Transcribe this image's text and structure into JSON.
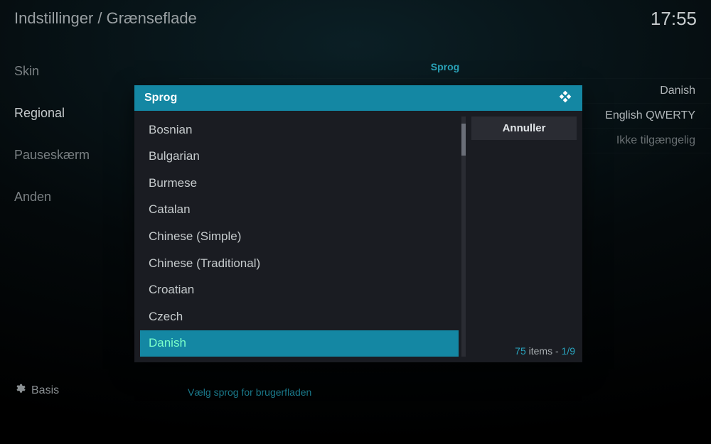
{
  "breadcrumb": "Indstillinger / Grænseflade",
  "clock": "17:55",
  "sidebar": {
    "items": [
      {
        "label": "Skin",
        "active": false
      },
      {
        "label": "Regional",
        "active": true
      },
      {
        "label": "Pauseskærm",
        "active": false
      },
      {
        "label": "Anden",
        "active": false
      }
    ]
  },
  "level": {
    "label": "Basis"
  },
  "main": {
    "section": "Sprog",
    "rows": [
      {
        "value": "Danish",
        "dim": false
      },
      {
        "value": "English QWERTY",
        "dim": false
      },
      {
        "value": "Ikke tilgængelig",
        "dim": true
      }
    ],
    "description": "Vælg sprog for brugerfladen"
  },
  "dialog": {
    "title": "Sprog",
    "items": [
      {
        "label": "Bosnian",
        "selected": false
      },
      {
        "label": "Bulgarian",
        "selected": false
      },
      {
        "label": "Burmese",
        "selected": false
      },
      {
        "label": "Catalan",
        "selected": false
      },
      {
        "label": "Chinese (Simple)",
        "selected": false
      },
      {
        "label": "Chinese (Traditional)",
        "selected": false
      },
      {
        "label": "Croatian",
        "selected": false
      },
      {
        "label": "Czech",
        "selected": false
      },
      {
        "label": "Danish",
        "selected": true
      }
    ],
    "cancel": "Annuller",
    "count_num": "75",
    "count_word": " items - ",
    "page": "1/9"
  }
}
